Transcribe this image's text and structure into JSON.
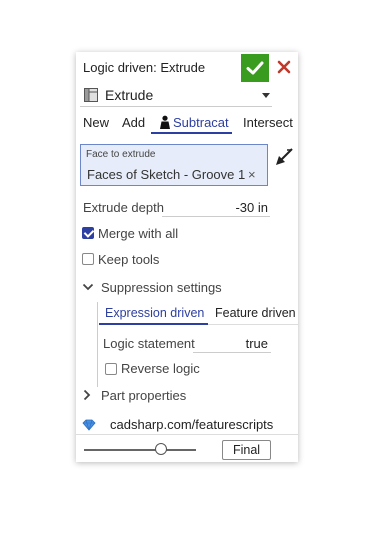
{
  "dialog": {
    "title": "Logic driven: Extrude",
    "ok_icon": "checkmark-icon",
    "cancel_icon": "close-icon",
    "accent_color": "#2d3fa0",
    "ok_color": "#3a9c1f",
    "cancel_color": "#c0392b"
  },
  "feature_select": {
    "value": "Extrude",
    "icon": "extrude-icon"
  },
  "operation_tabs": [
    {
      "label": "New",
      "active": false
    },
    {
      "label": "Add",
      "active": false
    },
    {
      "label": "Subtracat",
      "active": true
    },
    {
      "label": "Intersect",
      "active": false
    }
  ],
  "face_field": {
    "label": "Face to extrude",
    "value": "Faces of Sketch - Groove 1",
    "clear": "×"
  },
  "extrude_depth": {
    "label": "Extrude depth",
    "value": "-30 in"
  },
  "merge_with_all": {
    "label": "Merge with all",
    "checked": true
  },
  "keep_tools": {
    "label": "Keep tools",
    "checked": false
  },
  "suppression": {
    "label": "Suppression settings",
    "expanded": true,
    "tabs": [
      {
        "label": "Expression driven",
        "active": true
      },
      {
        "label": "Feature driven",
        "active": false
      }
    ],
    "logic_statement": {
      "label": "Logic statement",
      "value": "true"
    },
    "reverse_logic": {
      "label": "Reverse logic",
      "checked": false
    }
  },
  "part_properties": {
    "label": "Part properties",
    "expanded": false
  },
  "link": {
    "text": "cadsharp.com/featurescripts",
    "icon": "diamond-icon"
  },
  "footer": {
    "slider_value": 0.7,
    "final_label": "Final"
  }
}
